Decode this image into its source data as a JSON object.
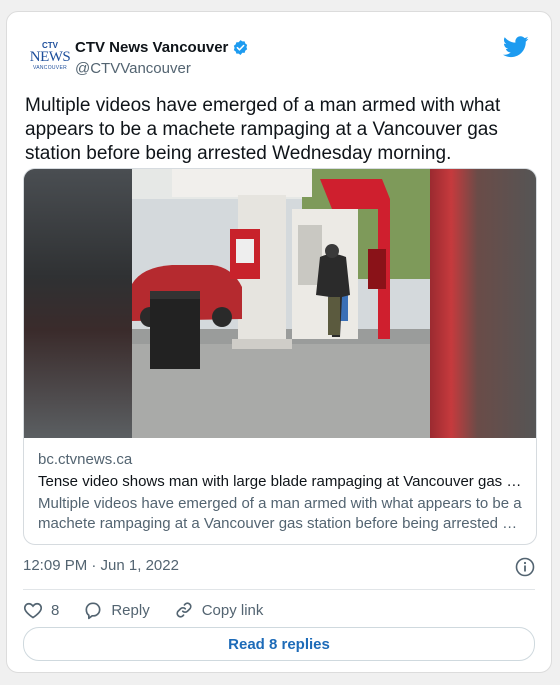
{
  "author": {
    "name": "CTV News Vancouver",
    "handle": "@CTVVancouver",
    "logo_lines": [
      "CTV",
      "NEWS",
      "VANCOUVER"
    ]
  },
  "tweet": {
    "text": "Multiple videos have emerged of a man armed with what appears to be a machete rampaging at a Vancouver gas station before being arrested Wednesday morning.",
    "timestamp": "12:09 PM · Jun 1, 2022"
  },
  "link_card": {
    "domain": "bc.ctvnews.ca",
    "title": "Tense video shows man with large blade rampaging at Vancouver gas …",
    "description_line1": "Multiple videos have emerged of a man armed with what appears to be a",
    "description_line2": "machete rampaging at a Vancouver gas station before being arrested …"
  },
  "actions": {
    "like_count": "8",
    "reply_label": "Reply",
    "copy_link_label": "Copy link"
  },
  "read_replies_label": "Read 8 replies",
  "colors": {
    "accent": "#1d9bf0",
    "brand": "#1d4e9b",
    "muted": "#536471"
  },
  "icons": [
    "verified-badge-icon",
    "twitter-bird-icon",
    "info-icon",
    "heart-icon",
    "reply-bubble-icon",
    "link-icon"
  ]
}
